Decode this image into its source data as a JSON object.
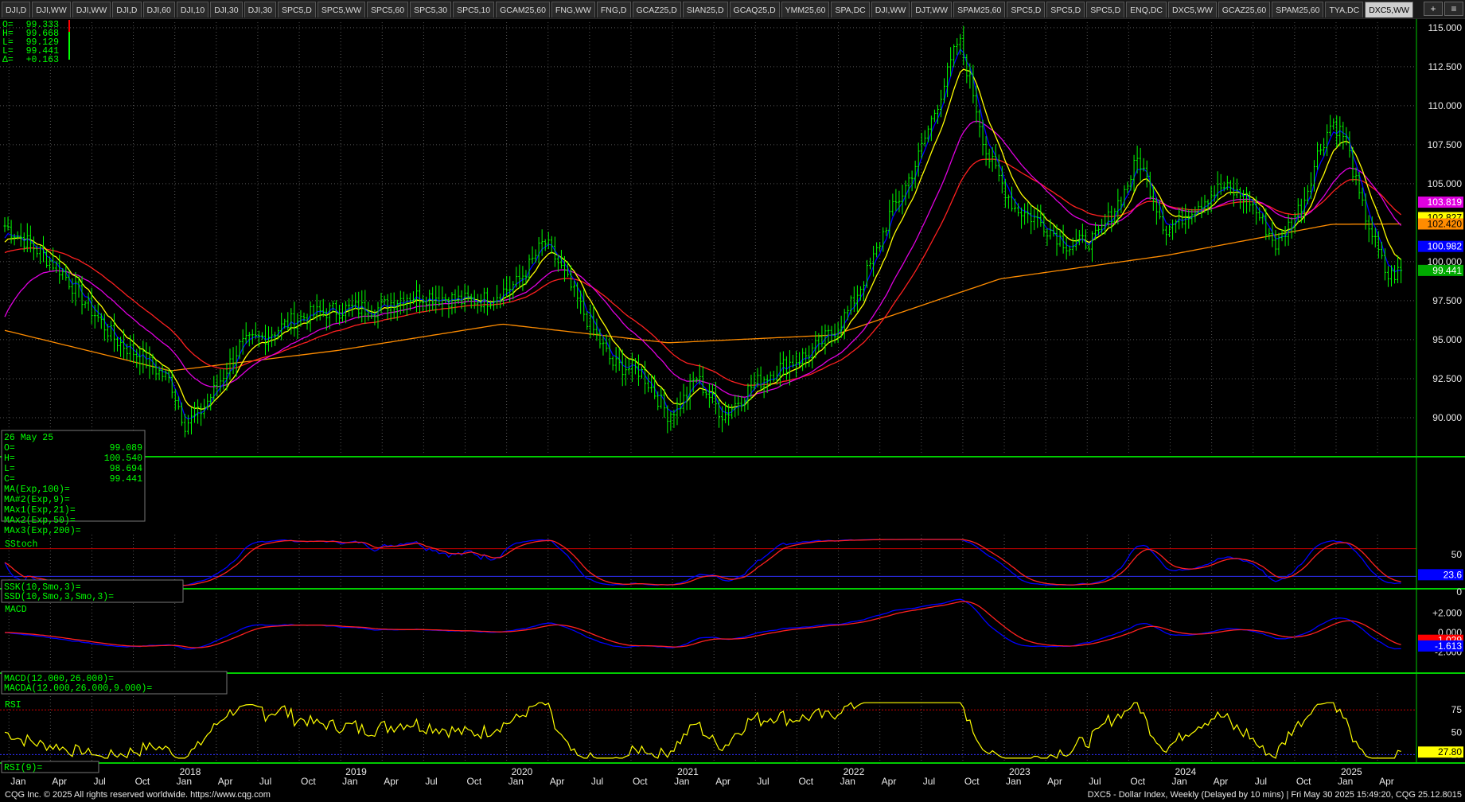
{
  "tabs": [
    "DJI,D",
    "DJI,WW",
    "DJI,WW",
    "DJI,D",
    "DJI,60",
    "DJI,10",
    "DJI,30",
    "DJI,30",
    "SPC5,D",
    "SPC5,WW",
    "SPC5,60",
    "SPC5,30",
    "SPC5,10",
    "GCAM25,60",
    "FNG,WW",
    "FNG,D",
    "GCAZ25,D",
    "SIAN25,D",
    "GCAQ25,D",
    "YMM25,60",
    "SPA,DC",
    "DJI,WW",
    "DJT,WW",
    "SPAM25,60",
    "SPC5,D",
    "SPC5,D",
    "SPC5,D",
    "ENQ,DC",
    "DXC5,WW",
    "GCAZ25,60",
    "SPAM25,60",
    "TYA,DC",
    "DXC5,WW"
  ],
  "active_tab_index": 32,
  "tab_tools": {
    "add": "+",
    "menu": "≡"
  },
  "ohlc_readout": {
    "rows": [
      {
        "label": "O=",
        "value": "99.333"
      },
      {
        "label": "H=",
        "value": "99.668"
      },
      {
        "label": "L=",
        "value": "99.129"
      },
      {
        "label": "L=",
        "value": "99.441"
      },
      {
        "label": "Δ=",
        "value": "+0.163"
      }
    ],
    "colors": {
      "bar_up": "#00ff00",
      "bar_down": "#ff0000"
    }
  },
  "price_axis": {
    "ticks": [
      "115.000",
      "112.500",
      "110.000",
      "107.500",
      "105.000",
      "100.000",
      "97.500",
      "95.000",
      "92.500",
      "90.000"
    ],
    "tick_values": [
      115,
      112.5,
      110,
      107.5,
      105,
      100,
      97.5,
      95,
      92.5,
      90
    ],
    "ymin": 87.6,
    "ymax": 115.35,
    "badges": [
      {
        "label": "103.819",
        "value": 103.819,
        "bg": "#e000e0",
        "fg": "#ffffff"
      },
      {
        "label": "102.827",
        "value": 102.827,
        "bg": "#ffff00",
        "fg": "#000000"
      },
      {
        "label": "102.420",
        "value": 102.42,
        "bg": "#ff8c00",
        "fg": "#000000"
      },
      {
        "label": "100.982",
        "value": 100.982,
        "bg": "#0000ff",
        "fg": "#ffffff"
      },
      {
        "label": "99.441",
        "value": 99.441,
        "bg": "#00aa00",
        "fg": "#ffffff"
      }
    ]
  },
  "info_box": {
    "date": "26 May 25",
    "rows": [
      {
        "label": "O=",
        "value": "99.089"
      },
      {
        "label": "H=",
        "value": "100.540"
      },
      {
        "label": "L=",
        "value": "98.694"
      },
      {
        "label": "C=",
        "value": "99.441"
      },
      {
        "label": "MA(Exp,100)=",
        "value": ""
      },
      {
        "label": "MA#2(Exp,9)=",
        "value": ""
      },
      {
        "label": "MAx1(Exp,21)=",
        "value": ""
      },
      {
        "label": "MAx2(Exp,50)=",
        "value": ""
      },
      {
        "label": "MAx3(Exp,200)=",
        "value": ""
      }
    ]
  },
  "sstoch": {
    "title": "SStoch",
    "legend": [
      "SSK(10,Smo,3)=",
      "SSD(10,Smo,3,Smo,3)="
    ],
    "ticks": [
      "50",
      "0"
    ],
    "badge": {
      "label": "23.6",
      "value": 23.6,
      "bg": "#0000ff",
      "fg": "#ffffff"
    }
  },
  "macd": {
    "title": "MACD",
    "legend": [
      "MACD(12.000,26.000)=",
      "MACDA(12.000,26.000,9.000)="
    ],
    "ticks": [
      "+2.000",
      "0.000",
      "-2.000"
    ],
    "badges": [
      {
        "label": "-1.029",
        "value": -1.029,
        "bg": "#ff0000",
        "fg": "#ffffff"
      },
      {
        "label": "-1.613",
        "value": -1.613,
        "bg": "#0000ff",
        "fg": "#ffffff"
      }
    ]
  },
  "rsi": {
    "title": "RSI",
    "legend": "RSI(9)=",
    "ticks": [
      "75",
      "50",
      "25"
    ],
    "badge": {
      "label": "27.80",
      "value": 27.8,
      "bg": "#ffff00",
      "fg": "#000000"
    }
  },
  "time_axis": {
    "labels": [
      {
        "text": "Jan",
        "t": 0.3,
        "year": false
      },
      {
        "text": "Apr",
        "t": 3.3,
        "year": false
      },
      {
        "text": "Jul",
        "t": 6.3,
        "year": false
      },
      {
        "text": "Oct",
        "t": 9.3,
        "year": false
      },
      {
        "text": "2018",
        "t": 12.3,
        "year": true
      },
      {
        "text": "Jan",
        "t": 12.3,
        "year": false
      },
      {
        "text": "Apr",
        "t": 15.3,
        "year": false
      },
      {
        "text": "Jul",
        "t": 18.3,
        "year": false
      },
      {
        "text": "Oct",
        "t": 21.3,
        "year": false
      },
      {
        "text": "2019",
        "t": 24.3,
        "year": true
      },
      {
        "text": "Jan",
        "t": 24.3,
        "year": false
      },
      {
        "text": "Apr",
        "t": 27.3,
        "year": false
      },
      {
        "text": "Jul",
        "t": 30.3,
        "year": false
      },
      {
        "text": "Oct",
        "t": 33.3,
        "year": false
      },
      {
        "text": "2020",
        "t": 36.3,
        "year": true
      },
      {
        "text": "Jan",
        "t": 36.3,
        "year": false
      },
      {
        "text": "Apr",
        "t": 39.3,
        "year": false
      },
      {
        "text": "Jul",
        "t": 42.3,
        "year": false
      },
      {
        "text": "Oct",
        "t": 45.3,
        "year": false
      },
      {
        "text": "2021",
        "t": 48.3,
        "year": true
      },
      {
        "text": "Jan",
        "t": 48.3,
        "year": false
      },
      {
        "text": "Apr",
        "t": 51.3,
        "year": false
      },
      {
        "text": "Jul",
        "t": 54.3,
        "year": false
      },
      {
        "text": "Oct",
        "t": 57.3,
        "year": false
      },
      {
        "text": "2022",
        "t": 60.3,
        "year": true
      },
      {
        "text": "Jan",
        "t": 60.3,
        "year": false
      },
      {
        "text": "Apr",
        "t": 63.3,
        "year": false
      },
      {
        "text": "Jul",
        "t": 66.3,
        "year": false
      },
      {
        "text": "Oct",
        "t": 69.3,
        "year": false
      },
      {
        "text": "2023",
        "t": 72.3,
        "year": true
      },
      {
        "text": "Jan",
        "t": 72.3,
        "year": false
      },
      {
        "text": "Apr",
        "t": 75.3,
        "year": false
      },
      {
        "text": "Jul",
        "t": 78.3,
        "year": false
      },
      {
        "text": "Oct",
        "t": 81.3,
        "year": false
      },
      {
        "text": "2024",
        "t": 84.3,
        "year": true
      },
      {
        "text": "Jan",
        "t": 84.3,
        "year": false
      },
      {
        "text": "Apr",
        "t": 87.3,
        "year": false
      },
      {
        "text": "Jul",
        "t": 90.3,
        "year": false
      },
      {
        "text": "Oct",
        "t": 93.3,
        "year": false
      },
      {
        "text": "2025",
        "t": 96.3,
        "year": true
      },
      {
        "text": "Jan",
        "t": 96.3,
        "year": false
      },
      {
        "text": "Apr",
        "t": 99.3,
        "year": false
      }
    ]
  },
  "footer": {
    "left": "CQG Inc. © 2025 All rights reserved worldwide. https://www.cqg.com",
    "right": "DXC5 - Dollar Index, Weekly (Delayed by 10 mins) | Fri May 30 2025 15:49:20, CQG 25.12.8015"
  },
  "colors": {
    "grid": "#555555",
    "panel_border": "#00cc00",
    "ma9": "#0000ff",
    "ma21": "#ffff00",
    "ma50": "#e000e0",
    "ma100": "#ff2020",
    "ma200": "#ff8c00",
    "bars": "#00ff00",
    "rsi": "#ffff00",
    "refline": "#cc0000"
  },
  "chart_data": {
    "type": "line",
    "title": "DXC5 - Dollar Index, Weekly",
    "x_unit": "month index from Jan 2017",
    "series": [
      {
        "name": "DXC5",
        "x": [
          0,
          2,
          4,
          6,
          8,
          10,
          12,
          13,
          14,
          15,
          17,
          19,
          21,
          23,
          25,
          27,
          29,
          31,
          33,
          35,
          37,
          38,
          39,
          40,
          42,
          44,
          46,
          48,
          49,
          50,
          52,
          54,
          56,
          58,
          60,
          61,
          62,
          63,
          64,
          65,
          66,
          67,
          68,
          69,
          70,
          71,
          73,
          75,
          77,
          79,
          81,
          82,
          84,
          86,
          88,
          90,
          92,
          94,
          95,
          96,
          97,
          98,
          99,
          100,
          101
        ],
        "y": [
          102.3,
          101.0,
          99.5,
          97.2,
          95.0,
          93.8,
          92.3,
          89.6,
          90.2,
          91.5,
          94.6,
          95.3,
          96.3,
          96.8,
          97.0,
          97.0,
          97.8,
          97.8,
          97.5,
          97.6,
          98.6,
          99.8,
          101.3,
          100.0,
          96.5,
          93.4,
          93.0,
          90.2,
          91.0,
          92.6,
          90.1,
          92.0,
          93.2,
          94.0,
          95.6,
          96.8,
          98.6,
          100.5,
          103.0,
          104.5,
          106.5,
          109.0,
          111.5,
          114.3,
          111.0,
          107.0,
          103.5,
          102.5,
          101.0,
          101.5,
          104.5,
          106.7,
          102.0,
          103.5,
          104.8,
          104.0,
          101.0,
          104.0,
          107.0,
          109.0,
          107.9,
          104.0,
          101.5,
          99.0,
          99.4
        ]
      },
      {
        "name": "MA(Exp,200)",
        "x": [
          0,
          12,
          24,
          36,
          48,
          60,
          72,
          84,
          96,
          101
        ],
        "y": [
          95.6,
          93.0,
          94.3,
          96.0,
          94.8,
          95.3,
          98.9,
          100.4,
          102.4,
          102.42
        ]
      }
    ],
    "y_range": [
      87.6,
      115.35
    ]
  }
}
